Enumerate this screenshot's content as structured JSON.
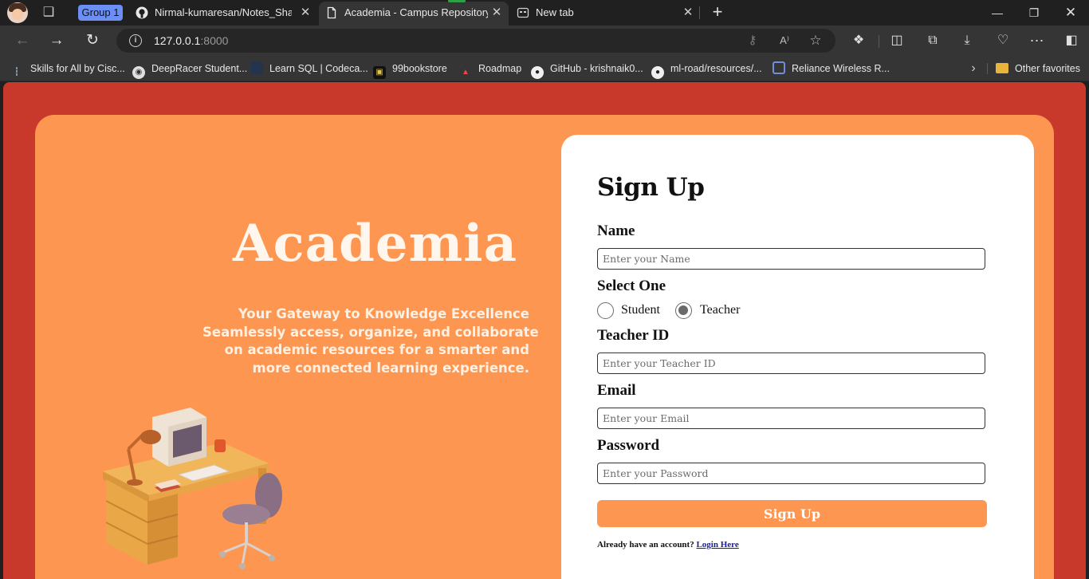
{
  "browser": {
    "tab_group_label": "Group 1",
    "tabs": [
      {
        "title": "Nirmal-kumaresan/Notes_Sharing",
        "icon": "github-icon"
      },
      {
        "title": "Academia - Campus Repository",
        "icon": "document-icon",
        "active": true
      },
      {
        "title": "New tab",
        "icon": "new-tab-page-icon"
      }
    ],
    "address": {
      "host": "127.0.0.1",
      "port": ":8000"
    },
    "favorites": [
      {
        "label": "Skills for All by Cisc...",
        "icon": "cisco-icon"
      },
      {
        "label": "DeepRacer Student...",
        "icon": "deepracer-icon"
      },
      {
        "label": "Learn SQL | Codeca...",
        "icon": "codecademy-icon"
      },
      {
        "label": "99bookstore",
        "icon": "bookstore-icon"
      },
      {
        "label": "Roadmap",
        "icon": "roadmap-icon"
      },
      {
        "label": "GitHub - krishnaik0...",
        "icon": "github-icon"
      },
      {
        "label": "ml-road/resources/...",
        "icon": "github-icon"
      },
      {
        "label": "Reliance Wireless R...",
        "icon": "reliance-icon"
      }
    ],
    "other_favorites": "Other favorites"
  },
  "page": {
    "brand": "Academia",
    "tagline": [
      "Your Gateway to Knowledge Excellence",
      "Seamlessly access, organize, and collaborate",
      "on academic resources for a smarter and",
      "more connected learning experience."
    ],
    "form": {
      "title": "Sign Up",
      "name_label": "Name",
      "name_placeholder": "Enter your Name",
      "select_label": "Select One",
      "role_options": [
        "Student",
        "Teacher"
      ],
      "selected_role": "Teacher",
      "teacher_id_label": "Teacher ID",
      "teacher_id_placeholder": "Enter your Teacher ID",
      "email_label": "Email",
      "email_placeholder": "Enter your Email",
      "password_label": "Password",
      "password_placeholder": "Enter your Password",
      "submit_label": "Sign Up",
      "login_prompt": "Already have an account?",
      "login_link": "Login Here"
    }
  },
  "colors": {
    "page_background": "#c8392b",
    "card_orange": "#fd9651",
    "form_background": "#ffffff",
    "link_blue": "#1a1aa6"
  }
}
